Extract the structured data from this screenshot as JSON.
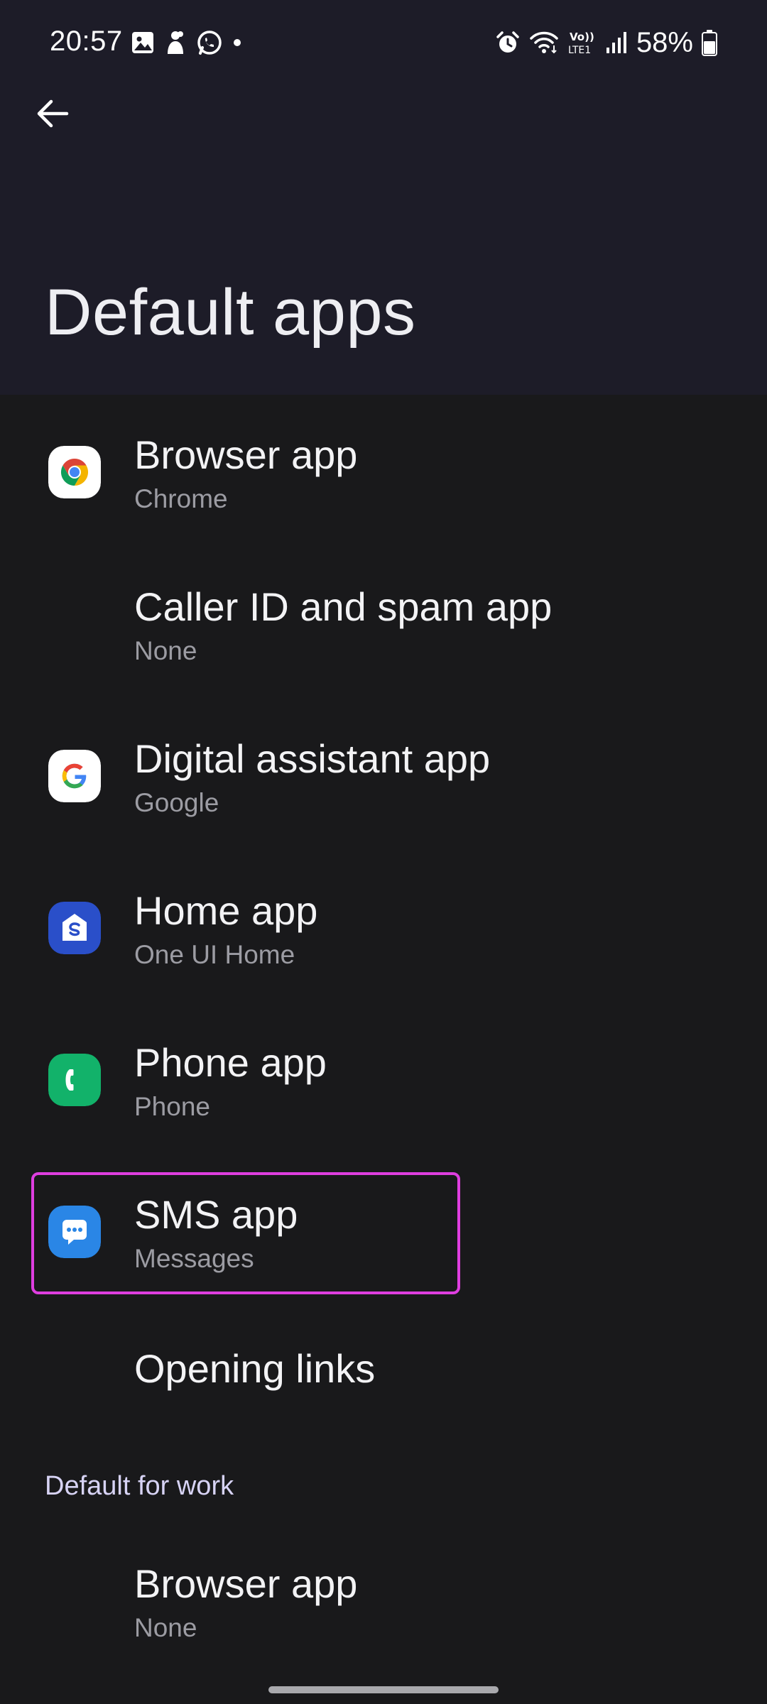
{
  "status_bar": {
    "time": "20:57",
    "battery": "58%",
    "left_icons": [
      "gallery-icon",
      "app-notification-icon",
      "whatsapp-icon",
      "dot-icon"
    ],
    "right_icons": [
      "alarm-icon",
      "wifi-icon",
      "volte-icon",
      "signal-icon",
      "battery-icon"
    ],
    "volte_label_top": "Vo))",
    "volte_label_bottom": "LTE1"
  },
  "header": {
    "title": "Default apps"
  },
  "items": [
    {
      "title": "Browser app",
      "subtitle": "Chrome",
      "icon": "chrome-icon"
    },
    {
      "title": "Caller ID and spam app",
      "subtitle": "None",
      "icon": ""
    },
    {
      "title": "Digital assistant app",
      "subtitle": "Google",
      "icon": "google-icon"
    },
    {
      "title": "Home app",
      "subtitle": "One UI Home",
      "icon": "one-ui-home-icon"
    },
    {
      "title": "Phone app",
      "subtitle": "Phone",
      "icon": "phone-icon"
    },
    {
      "title": "SMS app",
      "subtitle": "Messages",
      "icon": "messages-icon",
      "highlighted": true
    },
    {
      "title": "Opening links",
      "subtitle": "",
      "icon": ""
    }
  ],
  "work_section": {
    "header": "Default for work",
    "items": [
      {
        "title": "Browser app",
        "subtitle": "None"
      }
    ]
  },
  "colors": {
    "highlight": "#df3ee0",
    "background": "#19191b",
    "header_background": "#1d1c28"
  }
}
